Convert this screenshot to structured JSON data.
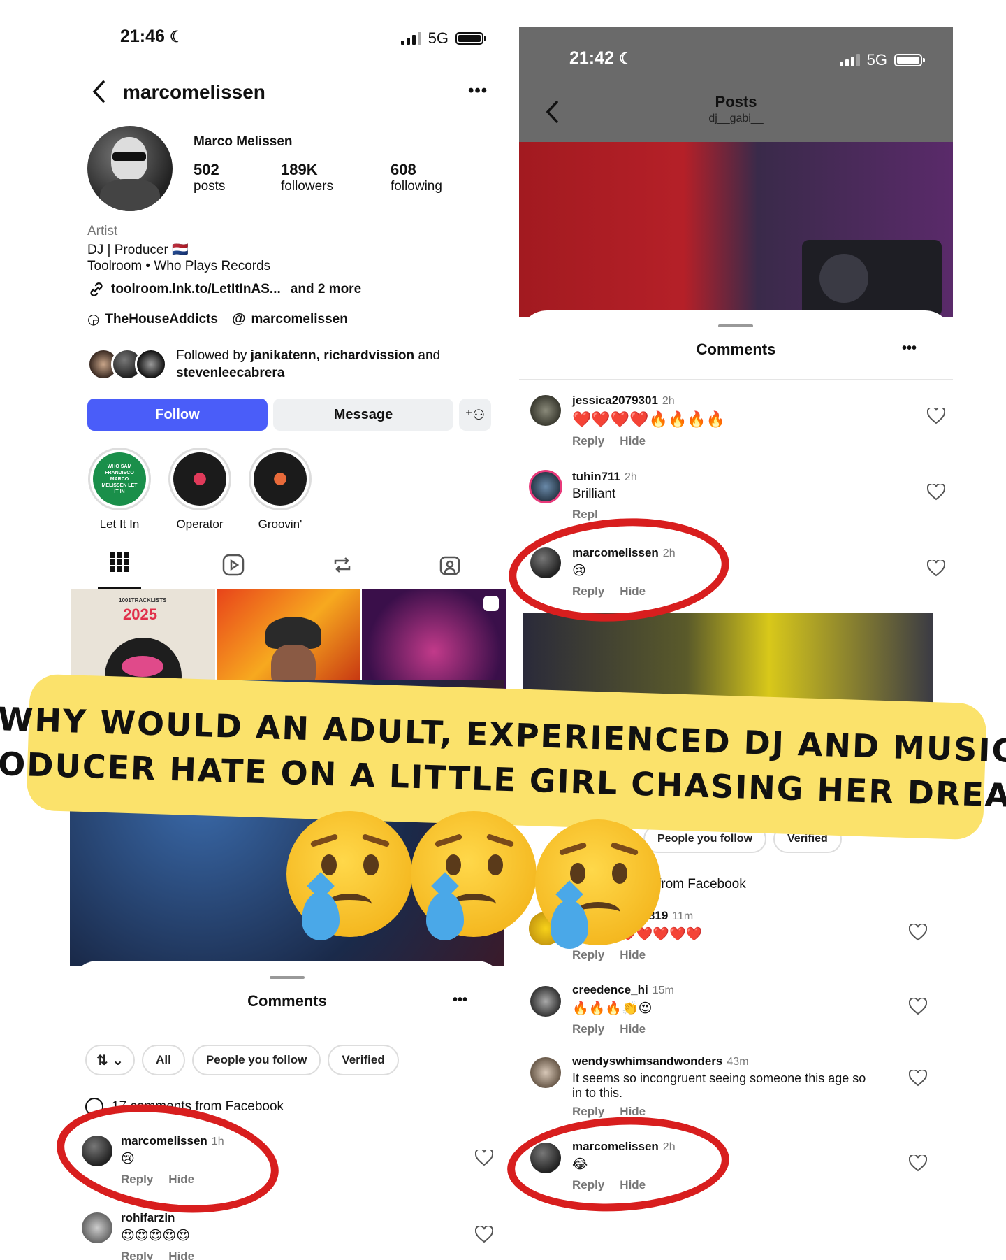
{
  "left_profile": {
    "status": {
      "time": "21:46",
      "network": "5G"
    },
    "header": {
      "username": "marcomelissen"
    },
    "profile": {
      "name": "Marco Melissen",
      "stats": [
        {
          "value": "502",
          "label": "posts"
        },
        {
          "value": "189K",
          "label": "followers"
        },
        {
          "value": "608",
          "label": "following"
        }
      ],
      "category": "Artist",
      "bio_line1": "DJ | Producer 🇳🇱",
      "bio_line2": "Toolroom • Who Plays Records",
      "link": "toolroom.lnk.to/LetItInAS...",
      "link_more": "and 2 more",
      "account1": "TheHouseAddicts",
      "account2": "marcomelissen",
      "followed_by_prefix": "Followed by ",
      "followed_by_names": "janikatenn, richardvission",
      "followed_by_and": " and",
      "followed_by_last": "stevenleecabrera"
    },
    "buttons": {
      "follow": "Follow",
      "message": "Message"
    },
    "highlights": [
      {
        "label": "Let It In",
        "cover_text": "WHO SAM FRANDISCO MARCO MELISSEN LET IT IN"
      },
      {
        "label": "Operator"
      },
      {
        "label": "Groovin'"
      }
    ],
    "grid_tile1_text": "1001TRACKLISTS",
    "grid_tile1_year": "2025"
  },
  "right_post": {
    "status": {
      "time": "21:42",
      "network": "5G"
    },
    "header": {
      "title": "Posts",
      "subtitle": "dj__gabi__"
    },
    "comments_title": "Comments",
    "comments": [
      {
        "user": "jessica2079301",
        "time": "2h",
        "text": "❤️❤️❤️❤️🔥🔥🔥🔥",
        "reply": "Reply",
        "hide": "Hide"
      },
      {
        "user": "tuhin711",
        "time": "2h",
        "text": "Brilliant",
        "reply": "Repl",
        "hide": ""
      },
      {
        "user": "marcomelissen",
        "time": "2h",
        "text": "😢",
        "reply": "Reply",
        "hide": "Hide"
      }
    ]
  },
  "left_comments": {
    "comments_title": "Comments",
    "filters": [
      "All",
      "People you follow",
      "Verified"
    ],
    "facebook_note": "17 comments from Facebook",
    "comments": [
      {
        "user": "marcomelissen",
        "time": "1h",
        "text": "😢",
        "reply": "Reply",
        "hide": "Hide"
      },
      {
        "user": "rohifarzin",
        "time": "",
        "text": "😍😍😍😍😍",
        "reply": "Reply",
        "hide": "Hide"
      }
    ]
  },
  "right_comments2": {
    "filters": [
      "People you follow",
      "Verified"
    ],
    "facebook_note": "from Facebook",
    "comments": [
      {
        "user": "37819",
        "time": "11m",
        "text": "❤️❤️❤️❤️❤️",
        "reply": "Reply",
        "hide": "Hide"
      },
      {
        "user": "creedence_hi",
        "time": "15m",
        "text": "🔥🔥🔥👏😍",
        "reply": "Reply",
        "hide": "Hide"
      },
      {
        "user": "wendyswhimsandwonders",
        "time": "43m",
        "text": "It seems so incongruent seeing someone this age so in to this.",
        "reply": "Reply",
        "hide": "Hide"
      },
      {
        "user": "marcomelissen",
        "time": "2h",
        "text": "😂",
        "reply": "Reply",
        "hide": "Hide"
      }
    ]
  },
  "banner": {
    "line1": "Why would an adult, experienced DJ and music",
    "line2": "producer hate on a little girl chasing her dream?"
  },
  "colors": {
    "follow_blue": "#4a5df9",
    "annotation_red": "#d81e1e",
    "banner_yellow": "#fbe26b"
  },
  "icons": [
    "back-chevron-icon",
    "more-dots-icon",
    "link-icon",
    "threads-icon",
    "add-person-icon",
    "grid-icon",
    "reels-icon",
    "repost-icon",
    "tagged-icon",
    "heart-icon",
    "sort-icon"
  ]
}
